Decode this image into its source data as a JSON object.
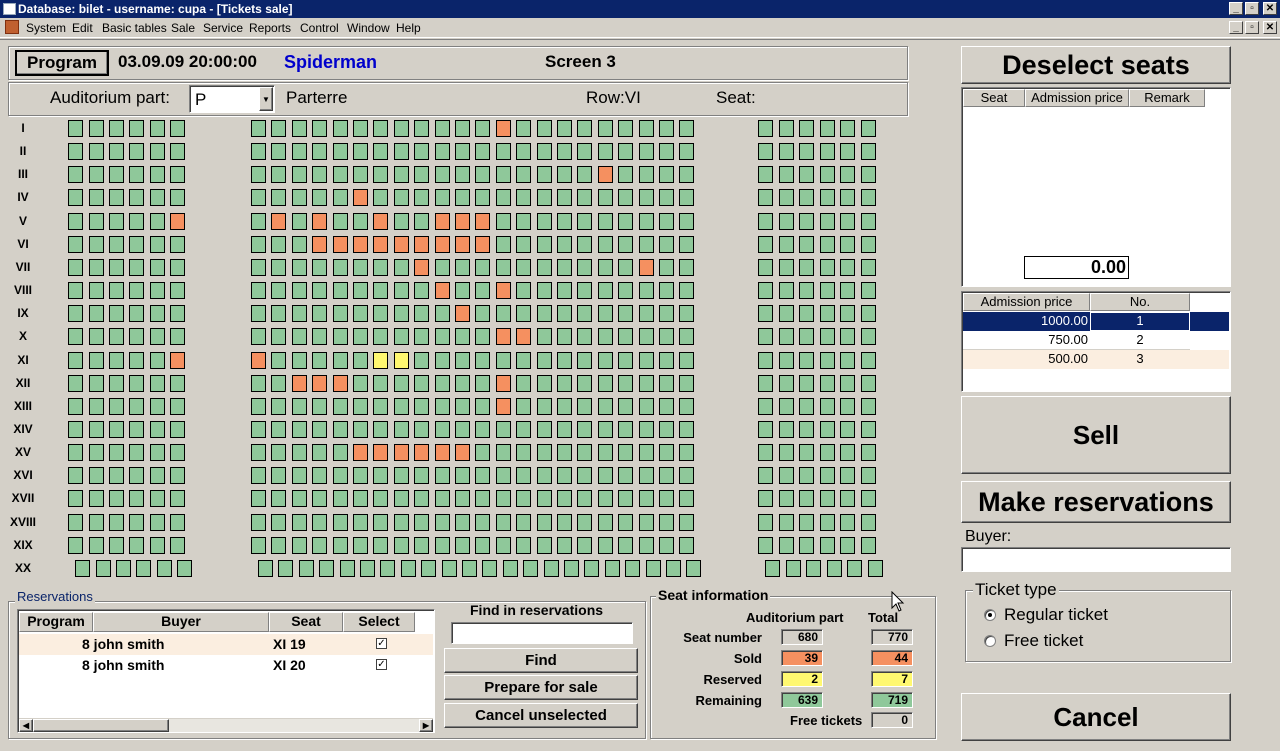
{
  "window": {
    "title": "Database: bilet  - username: cupa - [Tickets sale]"
  },
  "menu": [
    "System",
    "Edit",
    "Basic tables",
    "Sale",
    "Service",
    "Reports",
    "Control",
    "Window",
    "Help"
  ],
  "header": {
    "program_button": "Program",
    "datetime": "03.09.09 20:00:00",
    "movie": "Spiderman",
    "screen": "Screen 3",
    "auditorium_label": "Auditorium part:",
    "auditorium_value": "P",
    "auditorium_name": "Parterre",
    "row_label": "Row:VI",
    "seat_label": "Seat:"
  },
  "seatmap": {
    "rows": [
      "I",
      "II",
      "III",
      "IV",
      "V",
      "VI",
      "VII",
      "VIII",
      "IX",
      "X",
      "XI",
      "XII",
      "XIII",
      "XIV",
      "XV",
      "XVI",
      "XVII",
      "XVIII",
      "XIX",
      "XX"
    ],
    "sold": [
      [
        0,
        18
      ],
      [
        2,
        23
      ],
      [
        3,
        11
      ],
      [
        4,
        5
      ],
      [
        4,
        7
      ],
      [
        4,
        9
      ],
      [
        4,
        12
      ],
      [
        4,
        15
      ],
      [
        4,
        16
      ],
      [
        4,
        17
      ],
      [
        5,
        9
      ],
      [
        5,
        10
      ],
      [
        5,
        11
      ],
      [
        5,
        12
      ],
      [
        5,
        13
      ],
      [
        5,
        14
      ],
      [
        5,
        15
      ],
      [
        5,
        16
      ],
      [
        5,
        17
      ],
      [
        6,
        14
      ],
      [
        6,
        25
      ],
      [
        7,
        15
      ],
      [
        7,
        18
      ],
      [
        8,
        16
      ],
      [
        9,
        18
      ],
      [
        9,
        19
      ],
      [
        10,
        5
      ],
      [
        10,
        6
      ],
      [
        11,
        8
      ],
      [
        11,
        9
      ],
      [
        11,
        10
      ],
      [
        11,
        18
      ],
      [
        12,
        18
      ],
      [
        14,
        11
      ],
      [
        14,
        12
      ],
      [
        14,
        13
      ],
      [
        14,
        14
      ],
      [
        14,
        15
      ],
      [
        14,
        16
      ]
    ],
    "reserved": [
      [
        10,
        12
      ],
      [
        10,
        13
      ]
    ]
  },
  "reservations": {
    "group_title": "Reservations",
    "columns": [
      "Program",
      "Buyer",
      "Seat",
      "Select"
    ],
    "rows": [
      {
        "buyer": "8 john smith",
        "seat": "XI 19",
        "checked": "✓"
      },
      {
        "buyer": "8 john smith",
        "seat": "XI 20",
        "checked": "✓"
      }
    ],
    "find_label": "Find in reservations",
    "find_button": "Find",
    "prepare_button": "Prepare for sale",
    "cancel_unselected_button": "Cancel unselected"
  },
  "seat_info": {
    "title": "Seat information",
    "col_part": "Auditorium part",
    "col_total": "Total",
    "rows": [
      {
        "label": "Seat number",
        "part": "680",
        "total": "770",
        "color": "#d4d0c8"
      },
      {
        "label": "Sold",
        "part": "39",
        "total": "44",
        "color": "#f59060"
      },
      {
        "label": "Reserved",
        "part": "2",
        "total": "7",
        "color": "#fff870"
      },
      {
        "label": "Remaining",
        "part": "639",
        "total": "719",
        "color": "#8fc89a"
      }
    ],
    "free_label": "Free tickets",
    "free_value": "0"
  },
  "right": {
    "deselect_button": "Deselect seats",
    "selected_columns": [
      "Seat",
      "Admission price",
      "Remark"
    ],
    "total": "0.00",
    "price_columns": [
      "Admission price",
      "No."
    ],
    "prices": [
      {
        "price": "1000.00",
        "no": "1"
      },
      {
        "price": "750.00",
        "no": "2"
      },
      {
        "price": "500.00",
        "no": "3"
      }
    ],
    "sell_button": "Sell",
    "reserve_button": "Make reservations",
    "buyer_label": "Buyer:",
    "buyer_value": "",
    "ticket_type_title": "Ticket type",
    "ticket_regular": "Regular ticket",
    "ticket_free": "Free ticket",
    "cancel_button": "Cancel"
  },
  "colors": {
    "free": "#8fc89a",
    "sold": "#f59060",
    "reserved": "#fff870",
    "selected_row": "#0a246a"
  }
}
